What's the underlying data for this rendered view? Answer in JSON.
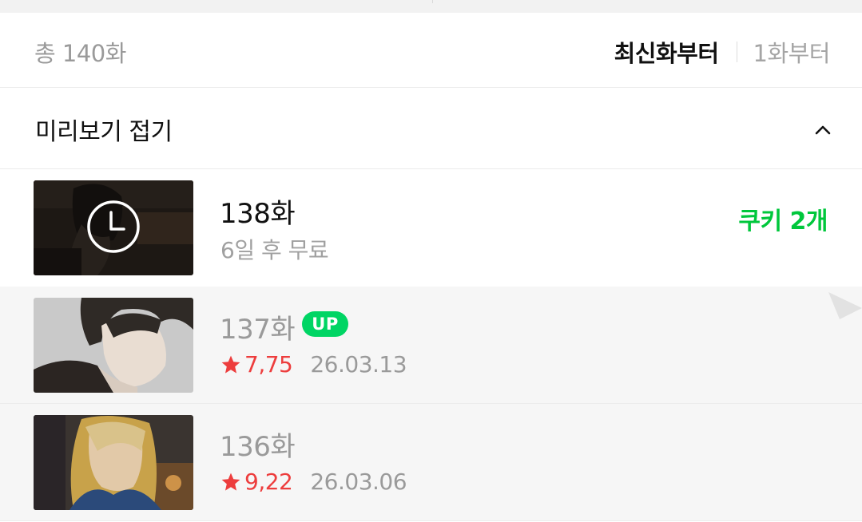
{
  "summary": {
    "total_count": "총 140화",
    "sort_latest": "최신화부터",
    "sort_first": "1화부터"
  },
  "preview": {
    "toggle_label": "미리보기 접기",
    "toggle_icon": "chevron-up-icon"
  },
  "episodes": [
    {
      "title": "138화",
      "status": "6일 후 무료",
      "price": "쿠키 2개",
      "overlay_icon": "clock-icon"
    },
    {
      "title": "137화",
      "badge": "UP",
      "rating": "7,75",
      "date": "26.03.13"
    },
    {
      "title": "136화",
      "rating": "9,22",
      "date": "26.03.06"
    }
  ],
  "colors": {
    "accent_green": "#00c73c",
    "badge_green": "#00d564",
    "rating_red": "#ed3d3d"
  }
}
